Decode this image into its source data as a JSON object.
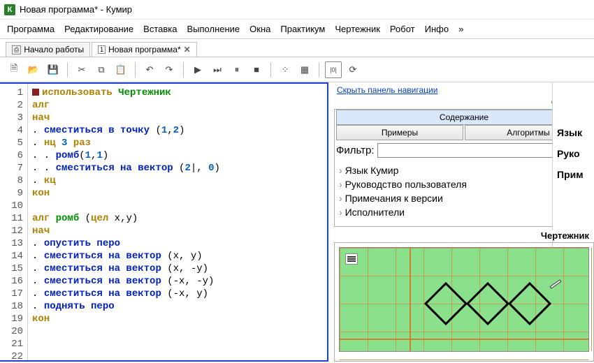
{
  "title": "Новая программа* - Кумир",
  "app_icon_letter": "К",
  "menu": [
    "Программа",
    "Редактирование",
    "Вставка",
    "Выполнение",
    "Окна",
    "Практикум",
    "Чертежник",
    "Робот",
    "Инфо",
    "»"
  ],
  "tabs": [
    {
      "icon": "⎙",
      "label": "Начало работы",
      "active": false,
      "closable": false
    },
    {
      "icon": "1",
      "label": "Новая программа*",
      "active": true,
      "closable": true
    }
  ],
  "code_lines": [
    {
      "n": 1,
      "bp": true,
      "tokens": [
        {
          "t": "использовать ",
          "c": "kw"
        },
        {
          "t": "Чертежник",
          "c": "name"
        }
      ]
    },
    {
      "n": 2,
      "tokens": [
        {
          "t": "алг",
          "c": "kw"
        }
      ]
    },
    {
      "n": 3,
      "tokens": [
        {
          "t": "нач",
          "c": "kw"
        }
      ]
    },
    {
      "n": 4,
      "tokens": [
        {
          "t": ". ",
          "c": ""
        },
        {
          "t": "сместиться в точку",
          "c": "cmd"
        },
        {
          "t": " (",
          "c": ""
        },
        {
          "t": "1",
          "c": "num"
        },
        {
          "t": ",",
          "c": ""
        },
        {
          "t": "2",
          "c": "num"
        },
        {
          "t": ")",
          "c": ""
        }
      ]
    },
    {
      "n": 5,
      "tokens": [
        {
          "t": ". ",
          "c": ""
        },
        {
          "t": "нц",
          "c": "kw"
        },
        {
          "t": " ",
          "c": ""
        },
        {
          "t": "3",
          "c": "num"
        },
        {
          "t": " ",
          "c": ""
        },
        {
          "t": "раз",
          "c": "kw"
        }
      ]
    },
    {
      "n": 6,
      "tokens": [
        {
          "t": ". . ",
          "c": ""
        },
        {
          "t": "ромб",
          "c": "cmd"
        },
        {
          "t": "(",
          "c": ""
        },
        {
          "t": "1",
          "c": "num"
        },
        {
          "t": ",",
          "c": ""
        },
        {
          "t": "1",
          "c": "num"
        },
        {
          "t": ")",
          "c": ""
        }
      ]
    },
    {
      "n": 7,
      "tokens": [
        {
          "t": ". . ",
          "c": ""
        },
        {
          "t": "сместиться на вектор",
          "c": "cmd"
        },
        {
          "t": " (",
          "c": ""
        },
        {
          "t": "2",
          "c": "num"
        },
        {
          "t": "|, ",
          "c": ""
        },
        {
          "t": "0",
          "c": "num"
        },
        {
          "t": ")",
          "c": ""
        }
      ]
    },
    {
      "n": 8,
      "tokens": [
        {
          "t": ". ",
          "c": ""
        },
        {
          "t": "кц",
          "c": "kw"
        }
      ]
    },
    {
      "n": 9,
      "tokens": [
        {
          "t": "кон",
          "c": "kw"
        }
      ]
    },
    {
      "n": 10,
      "tokens": []
    },
    {
      "n": 11,
      "tokens": [
        {
          "t": "алг",
          "c": "kw"
        },
        {
          "t": " ",
          "c": ""
        },
        {
          "t": "ромб",
          "c": "name"
        },
        {
          "t": " (",
          "c": ""
        },
        {
          "t": "цел",
          "c": "kw"
        },
        {
          "t": " x,y)",
          "c": ""
        }
      ]
    },
    {
      "n": 12,
      "tokens": [
        {
          "t": "нач",
          "c": "kw"
        }
      ]
    },
    {
      "n": 13,
      "tokens": [
        {
          "t": ". ",
          "c": ""
        },
        {
          "t": "опустить перо",
          "c": "cmd"
        }
      ]
    },
    {
      "n": 14,
      "tokens": [
        {
          "t": ". ",
          "c": ""
        },
        {
          "t": "сместиться на вектор",
          "c": "cmd"
        },
        {
          "t": " (x, y)",
          "c": ""
        }
      ]
    },
    {
      "n": 15,
      "tokens": [
        {
          "t": ". ",
          "c": ""
        },
        {
          "t": "сместиться на вектор",
          "c": "cmd"
        },
        {
          "t": " (x, -y)",
          "c": ""
        }
      ]
    },
    {
      "n": 16,
      "tokens": [
        {
          "t": ". ",
          "c": ""
        },
        {
          "t": "сместиться на вектор",
          "c": "cmd"
        },
        {
          "t": " (-x, -y)",
          "c": ""
        }
      ]
    },
    {
      "n": 17,
      "tokens": [
        {
          "t": ". ",
          "c": ""
        },
        {
          "t": "сместиться на вектор",
          "c": "cmd"
        },
        {
          "t": " (-x, y)",
          "c": ""
        }
      ]
    },
    {
      "n": 18,
      "tokens": [
        {
          "t": ". ",
          "c": ""
        },
        {
          "t": "поднять перо",
          "c": "cmd"
        }
      ]
    },
    {
      "n": 19,
      "tokens": [
        {
          "t": "кон",
          "c": "kw"
        }
      ]
    },
    {
      "n": 20,
      "tokens": []
    },
    {
      "n": 21,
      "tokens": []
    },
    {
      "n": 22,
      "tokens": []
    }
  ],
  "help": {
    "panel_title": "Справка",
    "hide_nav": "Скрыть панель навигации",
    "tabs": {
      "contents": "Содержание",
      "examples": "Примеры",
      "algorithms": "Алгоритмы"
    },
    "filter_label": "Фильтр:",
    "filter_value": "",
    "tree": [
      "Язык Кумир",
      "Руководство пользователя",
      "Примечания к версии",
      "Исполнители"
    ],
    "side_items": [
      "Язык",
      "Руко",
      "Прим"
    ]
  },
  "drawer": {
    "title": "Чертежник"
  }
}
